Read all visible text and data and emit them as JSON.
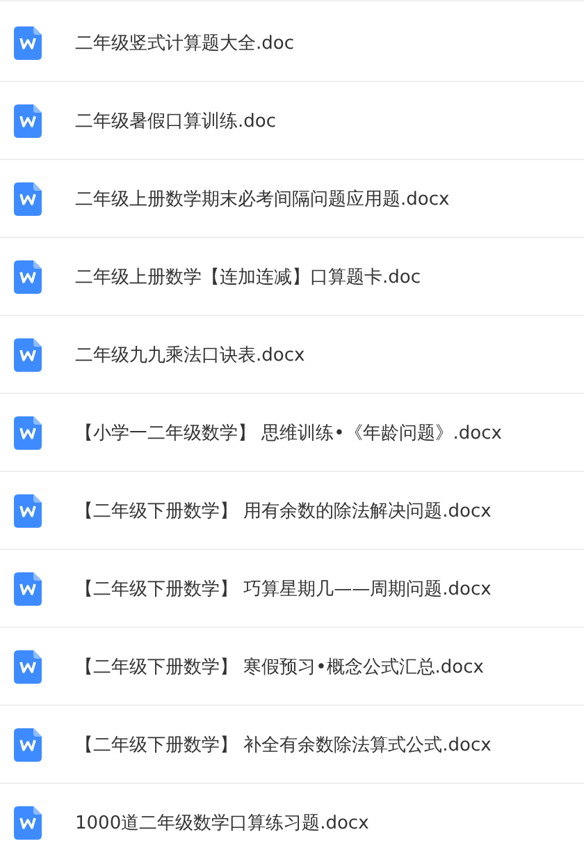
{
  "files": [
    {
      "name": "二年级竖式计算题大全.doc"
    },
    {
      "name": "二年级暑假口算训练.doc"
    },
    {
      "name": "二年级上册数学期末必考间隔问题应用题.docx"
    },
    {
      "name": "二年级上册数学【连加连减】口算题卡.doc"
    },
    {
      "name": "二年级九九乘法口诀表.docx"
    },
    {
      "name": "【小学一二年级数学】 思维训练•《年龄问题》.docx"
    },
    {
      "name": "【二年级下册数学】 用有余数的除法解决问题.docx"
    },
    {
      "name": "【二年级下册数学】 巧算星期几——周期问题.docx"
    },
    {
      "name": "【二年级下册数学】 寒假预习•概念公式汇总.docx"
    },
    {
      "name": "【二年级下册数学】 补全有余数除法算式公式.docx"
    },
    {
      "name": "1000道二年级数学口算练习题.docx"
    }
  ]
}
